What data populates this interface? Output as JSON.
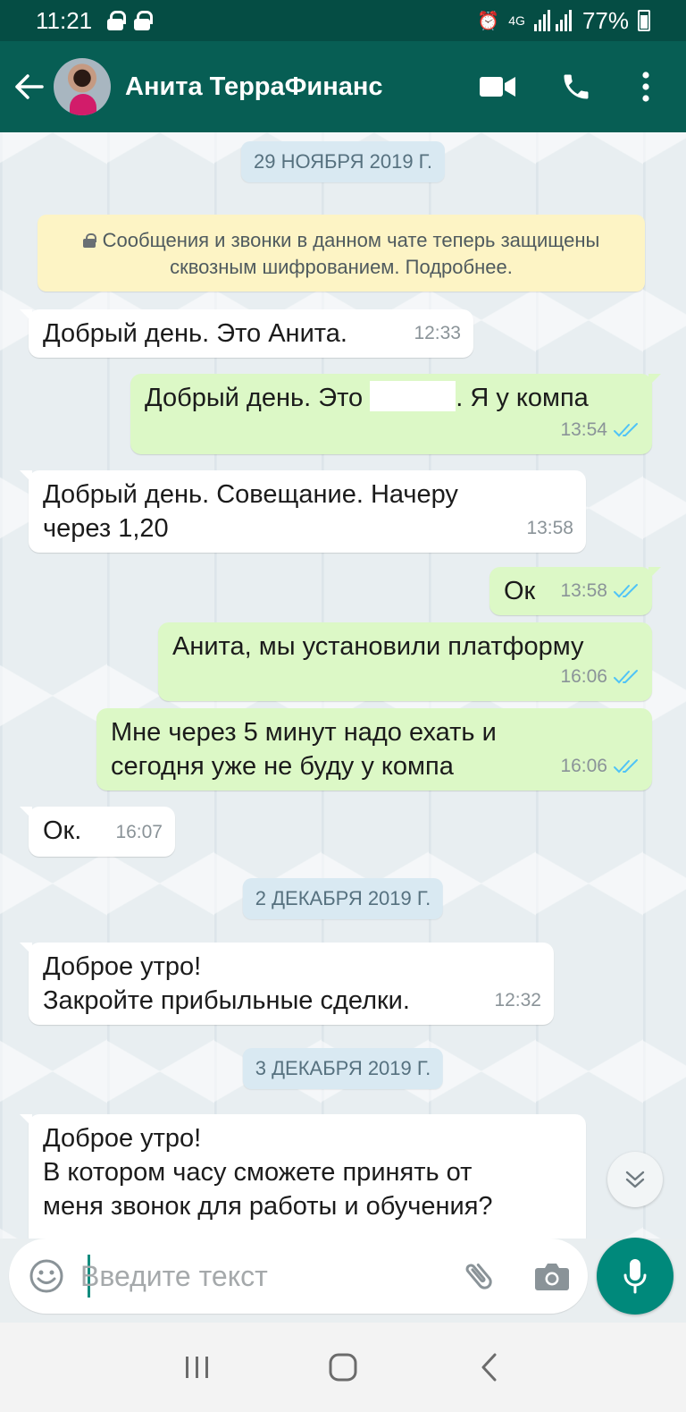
{
  "status_bar": {
    "time": "11:21",
    "network": "4G",
    "battery": "77%"
  },
  "header": {
    "contact_name": "Анита ТерраФинанс"
  },
  "dates": [
    "29 НОЯБРЯ 2019 Г.",
    "2 ДЕКАБРЯ 2019 Г.",
    "3 ДЕКАБРЯ 2019 Г."
  ],
  "encryption_notice": "Сообщения и звонки в данном чате теперь защищены сквозным шифрованием. Подробнее.",
  "messages": [
    {
      "dir": "in",
      "text": "Добрый день. Это Анита.",
      "time": "12:33"
    },
    {
      "dir": "out",
      "text_before": "Добрый день.  Это ",
      "text_after": ". Я у компа",
      "time": "13:54",
      "status": "read"
    },
    {
      "dir": "in",
      "text": "Добрый день. Совещание. Начеру\nчерез 1,20",
      "time": "13:58"
    },
    {
      "dir": "out",
      "text": "Ок",
      "time": "13:58",
      "status": "read"
    },
    {
      "dir": "out",
      "text": "Анита, мы установили платформу",
      "time": "16:06",
      "status": "read"
    },
    {
      "dir": "out",
      "text": "Мне через 5 минут надо ехать и\nсегодня уже не буду у компа",
      "time": "16:06",
      "status": "read"
    },
    {
      "dir": "in",
      "text": "Ок.",
      "time": "16:07"
    },
    {
      "dir": "in",
      "text": "Доброе утро!\nЗакройте прибыльные сделки.",
      "time": "12:32"
    },
    {
      "dir": "in",
      "text": "Доброе утро!\nВ котором часу сможете принять от\nменя звонок для работы и обучения?",
      "time": ""
    }
  ],
  "input": {
    "placeholder": "Введите текст",
    "value": ""
  },
  "colors": {
    "header": "#075e54",
    "status_bar": "#054d44",
    "outgoing_bubble": "#dcf8c6",
    "incoming_bubble": "#ffffff",
    "read_ticks": "#4fc3f7",
    "accent": "#00897b"
  },
  "icons": [
    "back-arrow-icon",
    "video-call-icon",
    "phone-icon",
    "more-vert-icon",
    "emoji-icon",
    "attach-icon",
    "camera-icon",
    "mic-icon",
    "scroll-down-icon",
    "recents-icon",
    "home-icon",
    "nav-back-icon"
  ]
}
